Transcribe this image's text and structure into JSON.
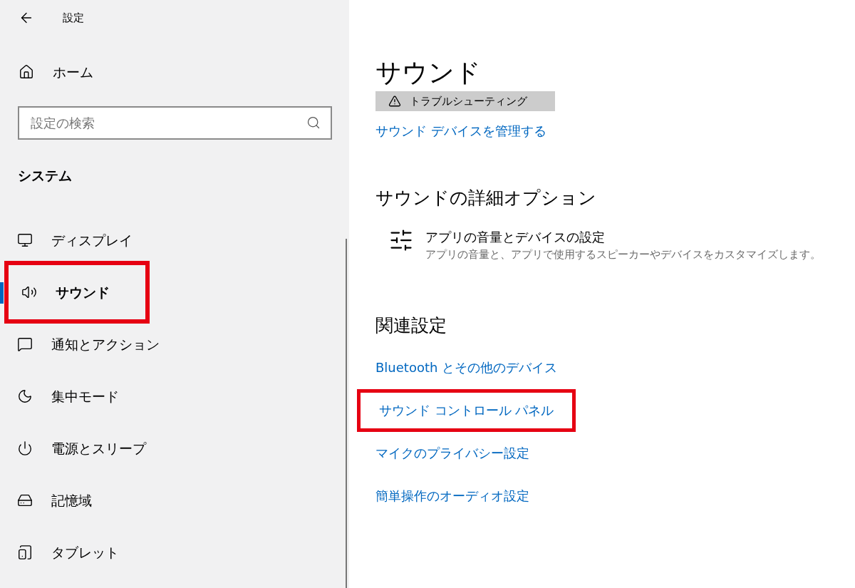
{
  "window": {
    "title": "設定"
  },
  "sidebar": {
    "home": "ホーム",
    "search": {
      "placeholder": "設定の検索"
    },
    "section": "システム",
    "items": [
      {
        "kind": "display",
        "label": "ディスプレイ",
        "selected": false,
        "highlighted": false
      },
      {
        "kind": "sound",
        "label": "サウンド",
        "selected": true,
        "highlighted": true
      },
      {
        "kind": "notify",
        "label": "通知とアクション",
        "selected": false,
        "highlighted": false
      },
      {
        "kind": "focus",
        "label": "集中モード",
        "selected": false,
        "highlighted": false
      },
      {
        "kind": "power",
        "label": "電源とスリープ",
        "selected": false,
        "highlighted": false
      },
      {
        "kind": "storage",
        "label": "記憶域",
        "selected": false,
        "highlighted": false
      },
      {
        "kind": "tablet",
        "label": "タブレット",
        "selected": false,
        "highlighted": false
      }
    ]
  },
  "content": {
    "title": "サウンド",
    "troubleshoot_button": "トラブルシューティング",
    "manage_link": "サウンド デバイスを管理する",
    "advanced": {
      "heading": "サウンドの詳細オプション",
      "item": {
        "title": "アプリの音量とデバイスの設定",
        "description": "アプリの音量と、アプリで使用するスピーカーやデバイスをカスタマイズします。"
      }
    },
    "related": {
      "heading": "関連設定",
      "links": [
        {
          "label": "Bluetooth とその他のデバイス",
          "highlighted": false
        },
        {
          "label": "サウンド コントロール パネル",
          "highlighted": true
        },
        {
          "label": "マイクのプライバシー設定",
          "highlighted": false
        },
        {
          "label": "簡単操作のオーディオ設定",
          "highlighted": false
        }
      ]
    }
  }
}
